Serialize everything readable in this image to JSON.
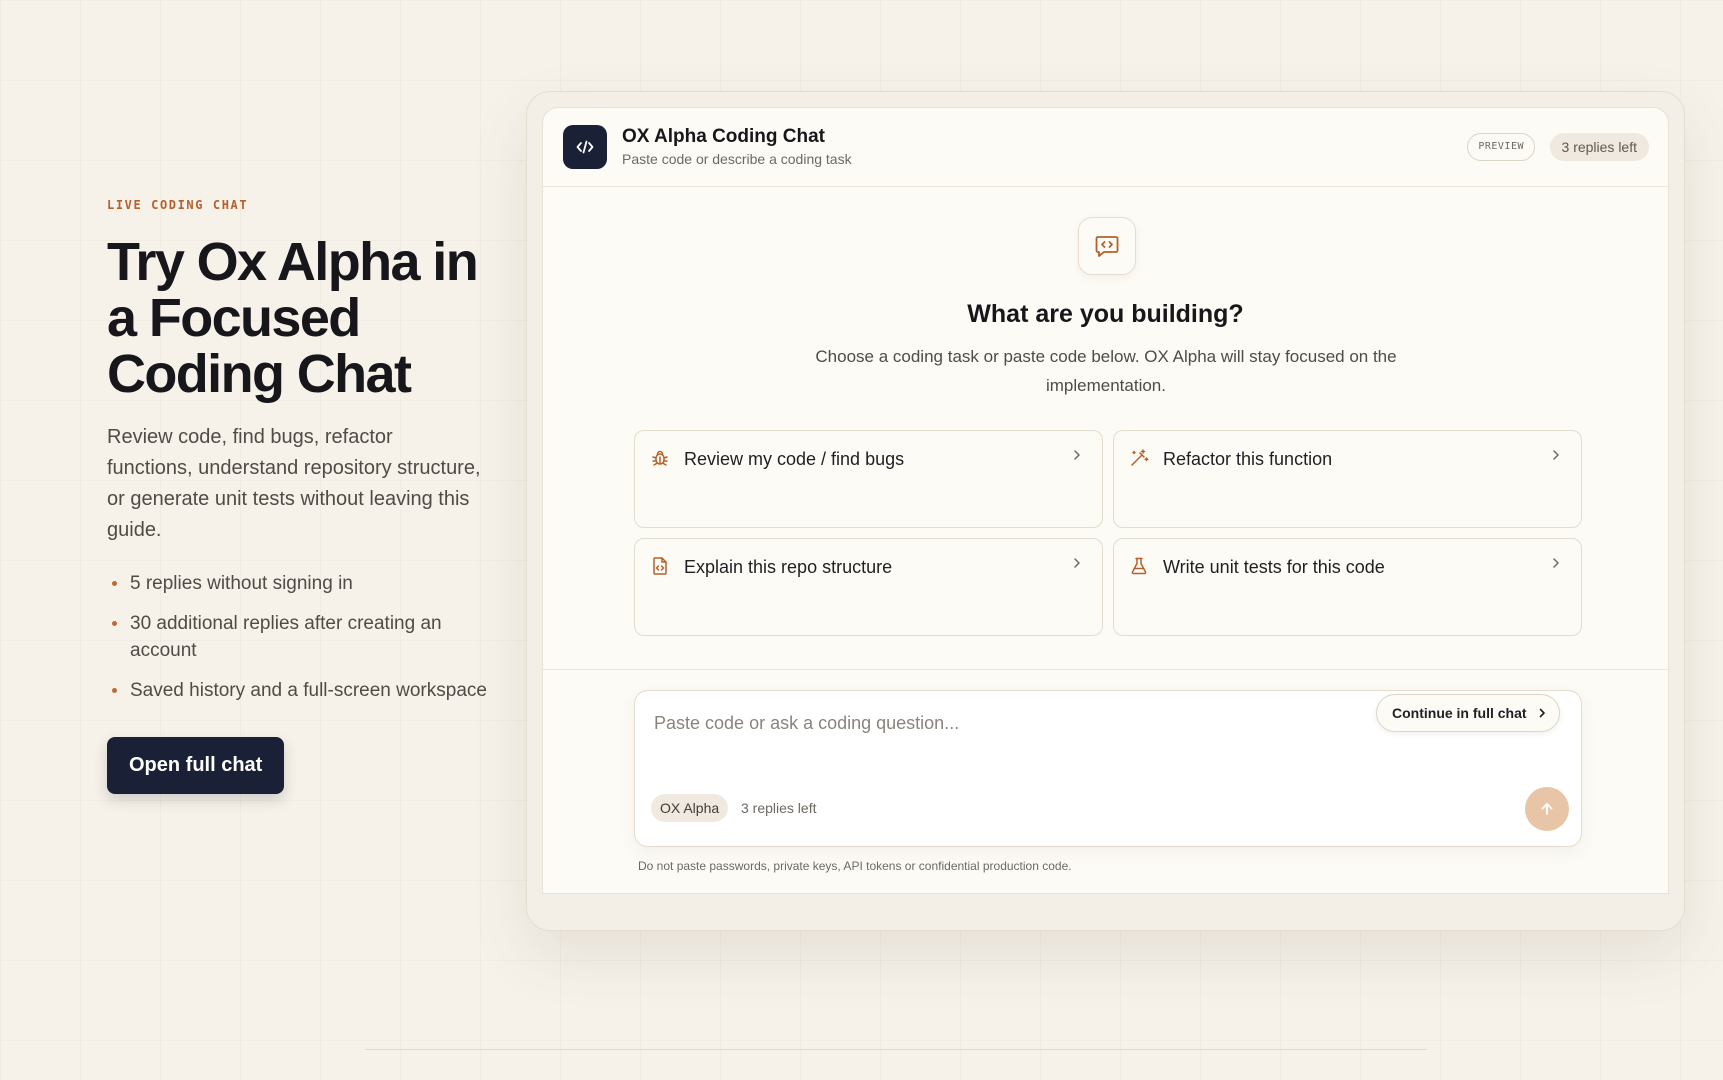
{
  "hero": {
    "eyebrow": "LIVE CODING CHAT",
    "title": "Try Ox Alpha in a Focused Coding Chat",
    "description": "Review code, find bugs, refactor functions, understand repository structure, or generate unit tests without leaving this guide.",
    "bullets": [
      "5 replies without signing in",
      "30 additional replies after creating an account",
      "Saved history and a full-screen workspace"
    ],
    "cta_label": "Open full chat"
  },
  "chat": {
    "header": {
      "logo_icon": "code-icon",
      "title": "OX Alpha Coding Chat",
      "subtitle": "Paste code or describe a coding task",
      "preview_badge": "PREVIEW",
      "replies_badge": "3 replies left"
    },
    "intro": {
      "icon": "code-message-icon",
      "question": "What are you building?",
      "subtext": "Choose a coding task or paste code below. OX Alpha will stay focused on the implementation."
    },
    "tasks": [
      {
        "label": "Review my code / find bugs",
        "icon": "bug-icon"
      },
      {
        "label": "Refactor this function",
        "icon": "magic-wand-icon"
      },
      {
        "label": "Explain this repo structure",
        "icon": "code-file-icon"
      },
      {
        "label": "Write unit tests for this code",
        "icon": "flask-icon"
      }
    ],
    "composer": {
      "placeholder": "Paste code or ask a coding question...",
      "continue_label": "Continue in full chat",
      "model": "OX Alpha",
      "replies_left": "3 replies left",
      "send_icon": "arrow-up-icon"
    },
    "disclaimer": "Do not paste passwords, private keys, API tokens or confidential production code."
  },
  "colors": {
    "accent": "#b4602c",
    "navy": "#1a2035",
    "background": "#f6f2ea",
    "send_button": "#e8c5a6"
  }
}
